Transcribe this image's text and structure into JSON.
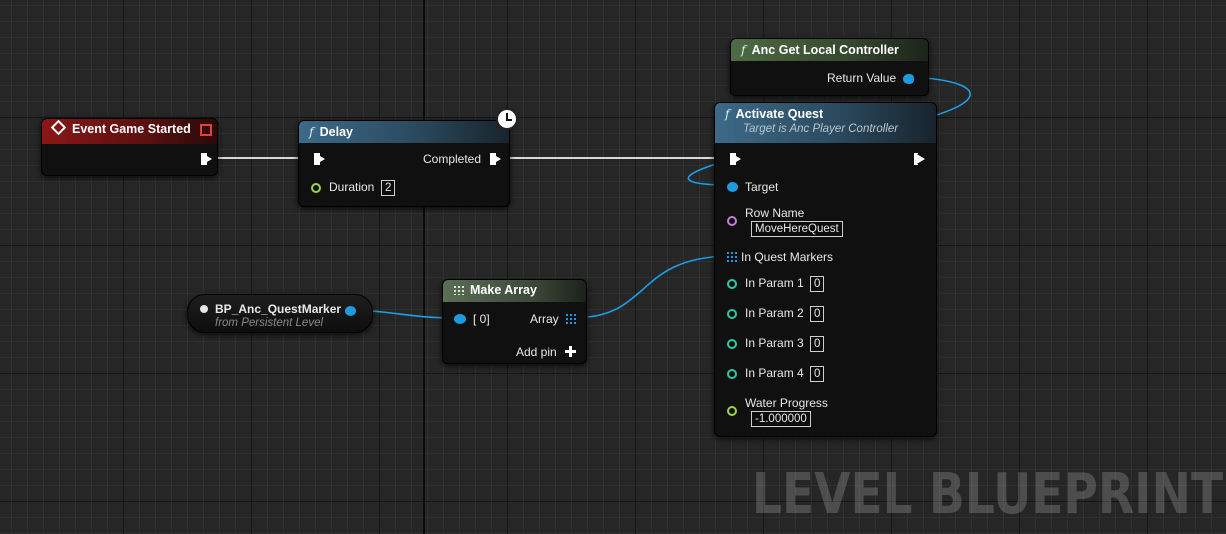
{
  "watermark": "LEVEL BLUEPRINT",
  "nodes": {
    "event_game_started": {
      "title": "Event Game Started"
    },
    "delay": {
      "title": "Delay",
      "output_label": "Completed",
      "duration_label": "Duration",
      "duration_value": "2"
    },
    "get_local_controller": {
      "title": "Anc Get Local Controller",
      "output_label": "Return Value"
    },
    "activate_quest": {
      "title": "Activate Quest",
      "subtitle": "Target is Anc Player Controller",
      "target_label": "Target",
      "row_name_label": "Row Name",
      "row_name_value": "MoveHereQuest",
      "markers_label": "In Quest Markers",
      "params": [
        {
          "label": "In Param 1",
          "value": "0"
        },
        {
          "label": "In Param 2",
          "value": "0"
        },
        {
          "label": "In Param 3",
          "value": "0"
        },
        {
          "label": "In Param 4",
          "value": "0"
        }
      ],
      "water_label": "Water Progress",
      "water_value": "-1.000000"
    },
    "quest_marker": {
      "title": "BP_Anc_QuestMarker",
      "subtitle": "from Persistent Level"
    },
    "make_array": {
      "title": "Make Array",
      "input_label": "[ 0]",
      "output_label": "Array",
      "add_pin_label": "Add pin"
    }
  },
  "colors": {
    "exec": "#ffffff",
    "object_pin": "#1e9be0",
    "name_pin": "#c77ce0",
    "int_pin": "#2ec8a0",
    "float_pin": "#9ed24a"
  }
}
